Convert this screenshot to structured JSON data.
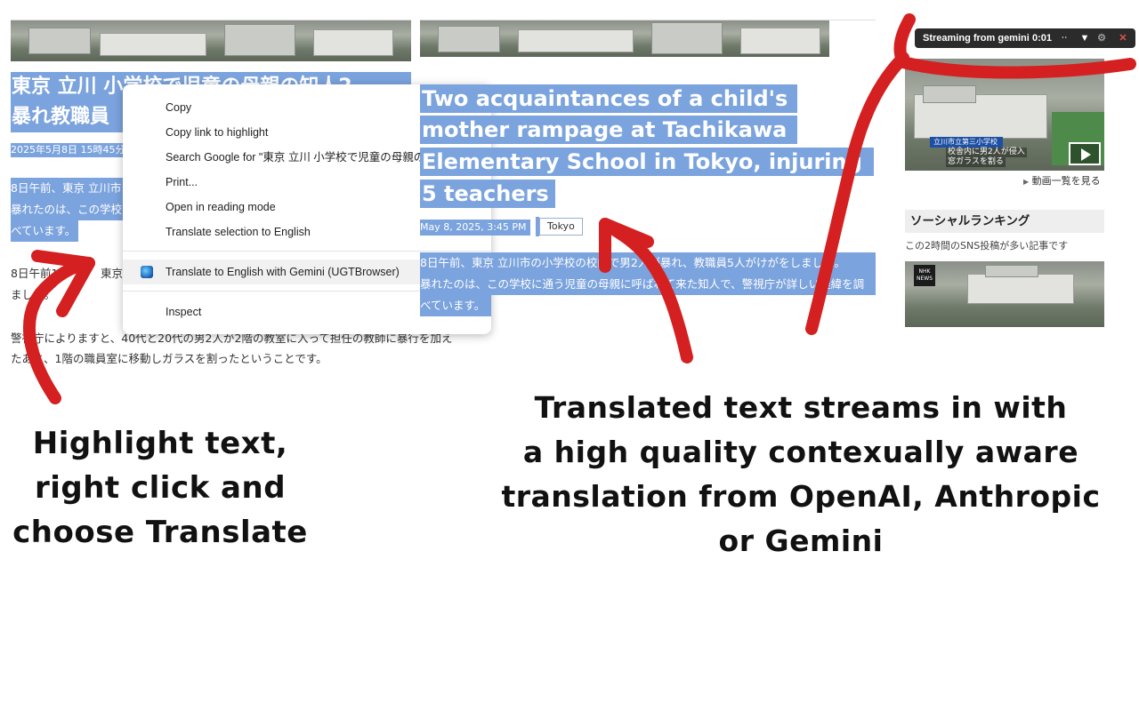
{
  "left_page": {
    "title_line1": "東京 立川 小学校で児童の母親の知人2",
    "title_line2": "暴れ教職員",
    "date": "2025年5月8日 15時45分",
    "para1_line1": "8日午前、東京 立川市",
    "para1_line2": "暴れたのは、この学校",
    "para1_line3": "べています。",
    "para2_line1": "8日午前11時",
    "para2_line1b": "東京",
    "para2_line2": "ました。",
    "para3_line1": "警視庁によりますと、40代と20代の男2人が2階の教室に入って担任の教師に暴行を加え",
    "para3_line2": "たあと、1階の職員室に移動しガラスを割ったということです。"
  },
  "context_menu": {
    "items": [
      "Copy",
      "Copy link to highlight",
      "Search Google for \"東京 立川 小学校で児童の母親の知",
      "Print...",
      "Open in reading mode",
      "Translate selection to English",
      "Translate to English with Gemini (UGTBrowser)",
      "Inspect"
    ],
    "icon": "gemini-app-icon"
  },
  "translated_page": {
    "title_lines": [
      "Two acquaintances of a child's",
      "mother rampage at Tachikawa",
      "Elementary School in Tokyo, injuring",
      "5 teachers"
    ],
    "date": "May 8, 2025, 3:45 PM",
    "tag": "Tokyo",
    "para_line1": "8日午前、東京 立川市の小学校の校内で男2人が暴れ、教職員5人がけがをしました。",
    "para_line2": "暴れたのは、この学校に通う児童の母親に呼ばれて来た知人で、警視庁が詳しい経緯を調",
    "para_line3": "べています。"
  },
  "stream_bar": {
    "label": "Streaming from gemini",
    "time": "0:01",
    "spinner": "ᆢ",
    "dropdown_icon": "▼",
    "settings_icon": "⚙",
    "close_icon": "✕"
  },
  "sidebar": {
    "video_caption_line1": "立川市立第三小学校",
    "video_caption_line2": "校舎内に男2人が侵入",
    "video_caption_line3": "窓ガラスを割る",
    "video_link": "動画一覧を見る",
    "ranking_heading": "ソーシャルランキング",
    "ranking_sub": "この2時間のSNS投稿が多い記事です",
    "nhk_logo": "NHK NEWS"
  },
  "annotations": {
    "left_line1": "Highlight text,",
    "left_line2": "right click and",
    "left_line3": "choose Translate",
    "right_line1": "Translated text streams in with",
    "right_line2": "a high quality contexually aware",
    "right_line3": "translation from OpenAI, Anthropic",
    "right_line4": "or Gemini"
  },
  "colors": {
    "selection": "#7ba3dd",
    "arrow_red": "#d42020",
    "stream_bar_bg": "#2b2b2b"
  }
}
